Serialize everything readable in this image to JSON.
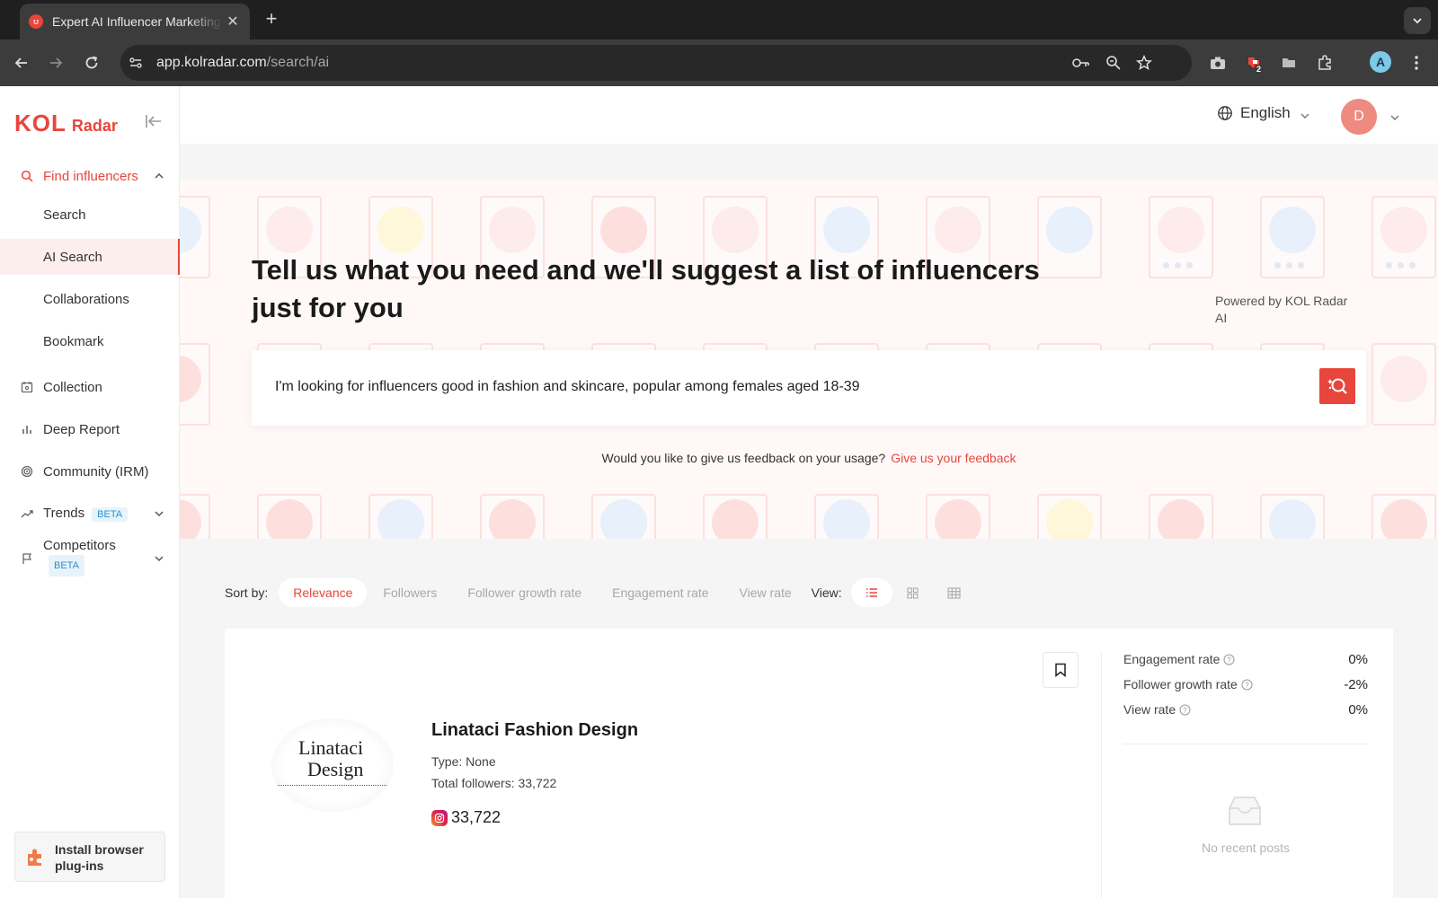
{
  "browser": {
    "tab_title": "Expert AI Influencer Marketing",
    "url_host": "app.kolradar.com",
    "url_path": "/search/ai",
    "profile_initial": "A",
    "extension_badge": "2"
  },
  "app": {
    "logo_kol": "KOL",
    "logo_radar": "Radar",
    "brand_color": "#e8453c"
  },
  "sidebar": {
    "find_influencers": "Find influencers",
    "sub_items": [
      "Search",
      "AI Search",
      "Collaborations",
      "Bookmark"
    ],
    "collection": "Collection",
    "deep_report": "Deep Report",
    "community": "Community (IRM)",
    "trends": "Trends",
    "competitors": "Competitors",
    "beta_label": "BETA",
    "install_label": "Install browser plug-ins"
  },
  "topbar": {
    "language": "English",
    "avatar_initial": "D"
  },
  "hero": {
    "title": "Tell us what you need and we'll suggest a list of influencers just for you",
    "powered_by": "Powered by KOL Radar AI",
    "search_value": "I'm looking for influencers good in fashion and skincare, popular among females aged 18-39",
    "feedback_question": "Would you like to give us feedback on your usage?",
    "feedback_link": "Give us your feedback"
  },
  "sort": {
    "label": "Sort by:",
    "options": [
      "Relevance",
      "Followers",
      "Follower growth rate",
      "Engagement rate",
      "View rate"
    ],
    "view_label": "View:"
  },
  "result": {
    "name": "Linataci Fashion Design",
    "image_line1": "Linataci",
    "image_line2": "Design",
    "type": "Type:  None",
    "total_followers": "Total followers:  33,722",
    "instagram_followers": "33,722",
    "metrics": [
      {
        "label": "Engagement rate",
        "value": "0%"
      },
      {
        "label": "Follower growth rate",
        "value": "-2%"
      },
      {
        "label": "View rate",
        "value": "0%"
      }
    ],
    "no_posts": "No recent posts"
  }
}
